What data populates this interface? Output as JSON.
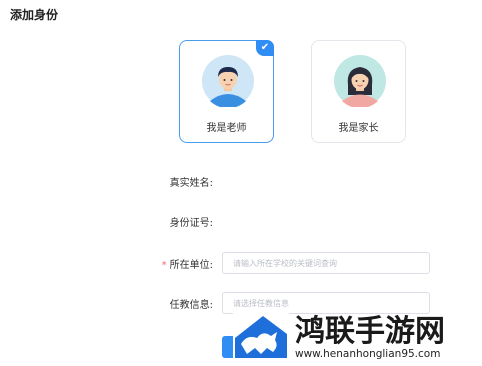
{
  "header": {
    "title": "添加身份"
  },
  "roles": [
    {
      "label": "我是老师",
      "selected": true
    },
    {
      "label": "我是家长",
      "selected": false
    }
  ],
  "selected_check": "✔",
  "form": {
    "real_name_label": "真实姓名:",
    "id_number_label": "身份证号:",
    "unit_label": "所在单位:",
    "unit_required_mark": "*",
    "unit_placeholder": "请输入所在学校的关键词查询",
    "teaching_label": "任教信息:",
    "teaching_placeholder": "请选择任教信息"
  },
  "watermark": {
    "title": "鸿联手游网",
    "url": "www.henanhonglian95.com"
  },
  "colors": {
    "accent": "#2f8df3",
    "required": "#f56c6c",
    "card_border": "#e3e6ea",
    "selected_border": "#4a9cf0"
  },
  "icons": {
    "teacher_avatar": "male-avatar-icon",
    "parent_avatar": "female-avatar-icon",
    "check": "check-icon",
    "logo": "house-logo-icon"
  }
}
